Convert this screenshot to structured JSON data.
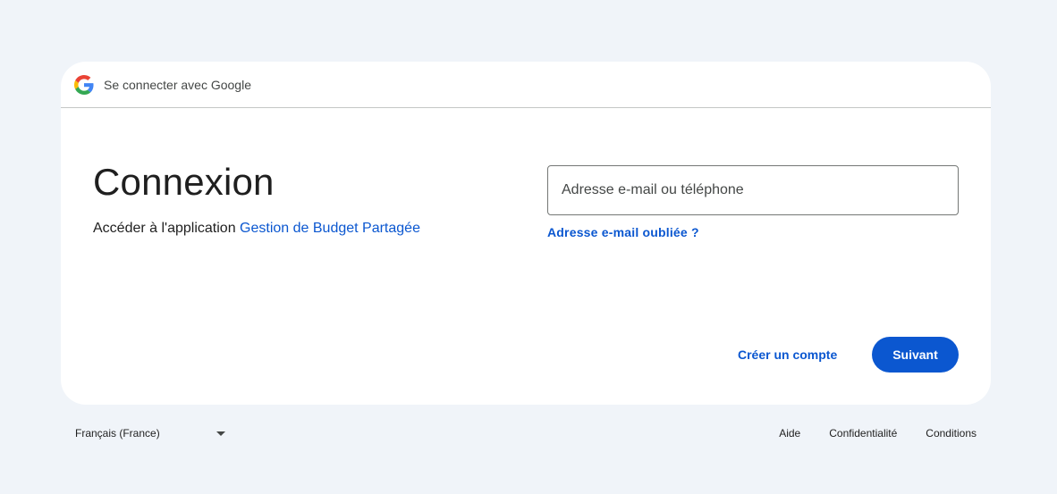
{
  "header": {
    "logo_icon": "google-g-icon",
    "text": "Se connecter avec Google"
  },
  "main": {
    "title": "Connexion",
    "subtitle_prefix": "Accéder à l'application ",
    "app_name": "Gestion de Budget Partagée"
  },
  "form": {
    "email_placeholder": "Adresse e-mail ou téléphone",
    "email_value": "",
    "forgot_email": "Adresse e-mail oubliée ?"
  },
  "actions": {
    "create_account": "Créer un compte",
    "next": "Suivant"
  },
  "footer": {
    "language": "Français (France)",
    "links": [
      "Aide",
      "Confidentialité",
      "Conditions"
    ]
  },
  "colors": {
    "accent": "#0b57d0",
    "background": "#f0f4f9",
    "card": "#ffffff"
  }
}
